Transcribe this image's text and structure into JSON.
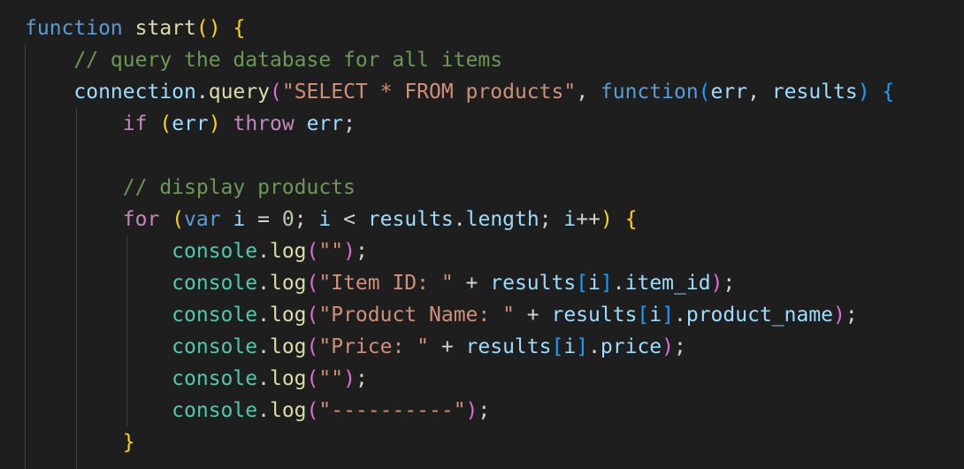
{
  "lines": [
    [
      {
        "t": "function",
        "c": "kw"
      },
      {
        "t": " ",
        "c": "op"
      },
      {
        "t": "start",
        "c": "fn"
      },
      {
        "t": "()",
        "c": "b1"
      },
      {
        "t": " ",
        "c": "op"
      },
      {
        "t": "{",
        "c": "b1"
      }
    ],
    [
      {
        "t": "    ",
        "c": "op"
      },
      {
        "t": "// query the database for all items",
        "c": "cmt"
      }
    ],
    [
      {
        "t": "    ",
        "c": "op"
      },
      {
        "t": "connection",
        "c": "var"
      },
      {
        "t": ".",
        "c": "op"
      },
      {
        "t": "query",
        "c": "fn"
      },
      {
        "t": "(",
        "c": "b2"
      },
      {
        "t": "\"SELECT * FROM products\"",
        "c": "str"
      },
      {
        "t": ", ",
        "c": "op"
      },
      {
        "t": "function",
        "c": "kw"
      },
      {
        "t": "(",
        "c": "b3"
      },
      {
        "t": "err",
        "c": "var"
      },
      {
        "t": ", ",
        "c": "op"
      },
      {
        "t": "results",
        "c": "var"
      },
      {
        "t": ")",
        "c": "b3"
      },
      {
        "t": " ",
        "c": "op"
      },
      {
        "t": "{",
        "c": "b3"
      }
    ],
    [
      {
        "t": "        ",
        "c": "op"
      },
      {
        "t": "if",
        "c": "ctl"
      },
      {
        "t": " ",
        "c": "op"
      },
      {
        "t": "(",
        "c": "b1"
      },
      {
        "t": "err",
        "c": "var"
      },
      {
        "t": ")",
        "c": "b1"
      },
      {
        "t": " ",
        "c": "op"
      },
      {
        "t": "throw",
        "c": "ctl"
      },
      {
        "t": " ",
        "c": "op"
      },
      {
        "t": "err",
        "c": "var"
      },
      {
        "t": ";",
        "c": "op"
      }
    ],
    [
      {
        "t": "",
        "c": "op"
      }
    ],
    [
      {
        "t": "        ",
        "c": "op"
      },
      {
        "t": "// display products",
        "c": "cmt"
      }
    ],
    [
      {
        "t": "        ",
        "c": "op"
      },
      {
        "t": "for",
        "c": "ctl"
      },
      {
        "t": " ",
        "c": "op"
      },
      {
        "t": "(",
        "c": "b1"
      },
      {
        "t": "var",
        "c": "kw"
      },
      {
        "t": " ",
        "c": "op"
      },
      {
        "t": "i",
        "c": "var"
      },
      {
        "t": " = ",
        "c": "op"
      },
      {
        "t": "0",
        "c": "num"
      },
      {
        "t": "; ",
        "c": "op"
      },
      {
        "t": "i",
        "c": "var"
      },
      {
        "t": " < ",
        "c": "op"
      },
      {
        "t": "results",
        "c": "var"
      },
      {
        "t": ".",
        "c": "op"
      },
      {
        "t": "length",
        "c": "var"
      },
      {
        "t": "; ",
        "c": "op"
      },
      {
        "t": "i",
        "c": "var"
      },
      {
        "t": "++",
        "c": "op"
      },
      {
        "t": ")",
        "c": "b1"
      },
      {
        "t": " ",
        "c": "op"
      },
      {
        "t": "{",
        "c": "b1"
      }
    ],
    [
      {
        "t": "            ",
        "c": "op"
      },
      {
        "t": "console",
        "c": "obj"
      },
      {
        "t": ".",
        "c": "op"
      },
      {
        "t": "log",
        "c": "fn"
      },
      {
        "t": "(",
        "c": "b2"
      },
      {
        "t": "\"\"",
        "c": "str"
      },
      {
        "t": ")",
        "c": "b2"
      },
      {
        "t": ";",
        "c": "op"
      }
    ],
    [
      {
        "t": "            ",
        "c": "op"
      },
      {
        "t": "console",
        "c": "obj"
      },
      {
        "t": ".",
        "c": "op"
      },
      {
        "t": "log",
        "c": "fn"
      },
      {
        "t": "(",
        "c": "b2"
      },
      {
        "t": "\"Item ID: \"",
        "c": "str"
      },
      {
        "t": " + ",
        "c": "op"
      },
      {
        "t": "results",
        "c": "var"
      },
      {
        "t": "[",
        "c": "b3"
      },
      {
        "t": "i",
        "c": "var"
      },
      {
        "t": "]",
        "c": "b3"
      },
      {
        "t": ".",
        "c": "op"
      },
      {
        "t": "item_id",
        "c": "var"
      },
      {
        "t": ")",
        "c": "b2"
      },
      {
        "t": ";",
        "c": "op"
      }
    ],
    [
      {
        "t": "            ",
        "c": "op"
      },
      {
        "t": "console",
        "c": "obj"
      },
      {
        "t": ".",
        "c": "op"
      },
      {
        "t": "log",
        "c": "fn"
      },
      {
        "t": "(",
        "c": "b2"
      },
      {
        "t": "\"Product Name: \"",
        "c": "str"
      },
      {
        "t": " + ",
        "c": "op"
      },
      {
        "t": "results",
        "c": "var"
      },
      {
        "t": "[",
        "c": "b3"
      },
      {
        "t": "i",
        "c": "var"
      },
      {
        "t": "]",
        "c": "b3"
      },
      {
        "t": ".",
        "c": "op"
      },
      {
        "t": "product_name",
        "c": "var"
      },
      {
        "t": ")",
        "c": "b2"
      },
      {
        "t": ";",
        "c": "op"
      }
    ],
    [
      {
        "t": "            ",
        "c": "op"
      },
      {
        "t": "console",
        "c": "obj"
      },
      {
        "t": ".",
        "c": "op"
      },
      {
        "t": "log",
        "c": "fn"
      },
      {
        "t": "(",
        "c": "b2"
      },
      {
        "t": "\"Price: \"",
        "c": "str"
      },
      {
        "t": " + ",
        "c": "op"
      },
      {
        "t": "results",
        "c": "var"
      },
      {
        "t": "[",
        "c": "b3"
      },
      {
        "t": "i",
        "c": "var"
      },
      {
        "t": "]",
        "c": "b3"
      },
      {
        "t": ".",
        "c": "op"
      },
      {
        "t": "price",
        "c": "var"
      },
      {
        "t": ")",
        "c": "b2"
      },
      {
        "t": ";",
        "c": "op"
      }
    ],
    [
      {
        "t": "            ",
        "c": "op"
      },
      {
        "t": "console",
        "c": "obj"
      },
      {
        "t": ".",
        "c": "op"
      },
      {
        "t": "log",
        "c": "fn"
      },
      {
        "t": "(",
        "c": "b2"
      },
      {
        "t": "\"\"",
        "c": "str"
      },
      {
        "t": ")",
        "c": "b2"
      },
      {
        "t": ";",
        "c": "op"
      }
    ],
    [
      {
        "t": "            ",
        "c": "op"
      },
      {
        "t": "console",
        "c": "obj"
      },
      {
        "t": ".",
        "c": "op"
      },
      {
        "t": "log",
        "c": "fn"
      },
      {
        "t": "(",
        "c": "b2"
      },
      {
        "t": "\"----------\"",
        "c": "str"
      },
      {
        "t": ")",
        "c": "b2"
      },
      {
        "t": ";",
        "c": "op"
      }
    ],
    [
      {
        "t": "        ",
        "c": "op"
      },
      {
        "t": "}",
        "c": "b1"
      }
    ]
  ]
}
